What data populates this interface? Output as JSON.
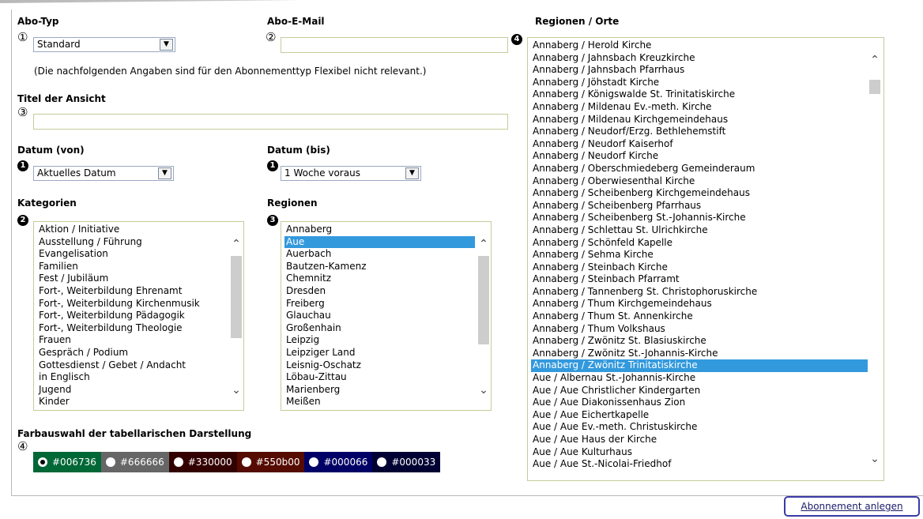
{
  "abo_typ": {
    "label": "Abo-Typ",
    "marker": "①",
    "value": "Standard"
  },
  "abo_email": {
    "label": "Abo-E-Mail",
    "marker": "②",
    "value": ""
  },
  "note": "(Die nachfolgenden Angaben sind für den Abonnementtyp Flexibel nicht relevant.)",
  "titel": {
    "label": "Titel der Ansicht",
    "marker": "③",
    "value": ""
  },
  "datum_von": {
    "label": "Datum (von)",
    "marker": "1",
    "value": "Aktuelles Datum"
  },
  "datum_bis": {
    "label": "Datum (bis)",
    "marker": "1",
    "value": "1 Woche voraus"
  },
  "kategorien": {
    "label": "Kategorien",
    "marker": "2",
    "items": [
      "Aktion / Initiative",
      "Ausstellung / Führung",
      "Evangelisation",
      "Familien",
      "Fest / Jubiläum",
      "Fort-, Weiterbildung Ehrenamt",
      "Fort-, Weiterbildung Kirchenmusik",
      "Fort-, Weiterbildung Pädagogik",
      "Fort-, Weiterbildung Theologie",
      "Frauen",
      "Gespräch / Podium",
      "Gottesdienst / Gebet / Andacht",
      "in Englisch",
      "Jugend",
      "Kinder"
    ]
  },
  "regionen": {
    "label": "Regionen",
    "marker": "3",
    "selected_index": 1,
    "items": [
      "Annaberg",
      "Aue",
      "Auerbach",
      "Bautzen-Kamenz",
      "Chemnitz",
      "Dresden",
      "Freiberg",
      "Glauchau",
      "Großenhain",
      "Leipzig",
      "Leipziger Land",
      "Leisnig-Oschatz",
      "Löbau-Zittau",
      "Marienberg",
      "Meißen"
    ]
  },
  "orte": {
    "label": "Regionen / Orte",
    "marker": "4",
    "selected_index": 26,
    "items": [
      "Annaberg / Herold Kirche",
      "Annaberg / Jahnsbach Kreuzkirche",
      "Annaberg / Jahnsbach Pfarrhaus",
      "Annaberg / Jöhstadt Kirche",
      "Annaberg / Königswalde St. Trinitatiskirche",
      "Annaberg / Mildenau Ev.-meth. Kirche",
      "Annaberg / Mildenau Kirchgemeindehaus",
      "Annaberg / Neudorf/Erzg. Bethlehemstift",
      "Annaberg / Neudorf Kaiserhof",
      "Annaberg / Neudorf Kirche",
      "Annaberg / Oberschmiedeberg Gemeinderaum",
      "Annaberg / Oberwiesenthal Kirche",
      "Annaberg / Scheibenberg Kirchgemeindehaus",
      "Annaberg / Scheibenberg Pfarrhaus",
      "Annaberg / Scheibenberg St.-Johannis-Kirche",
      "Annaberg / Schlettau St. Ulrichkirche",
      "Annaberg / Schönfeld Kapelle",
      "Annaberg / Sehma Kirche",
      "Annaberg / Steinbach Kirche",
      "Annaberg / Steinbach Pfarramt",
      "Annaberg / Tannenberg St. Christophoruskirche",
      "Annaberg / Thum Kirchgemeindehaus",
      "Annaberg / Thum St. Annenkirche",
      "Annaberg / Thum Volkshaus",
      "Annaberg / Zwönitz St. Blasiuskirche",
      "Annaberg / Zwönitz St.-Johannis-Kirche",
      "Annaberg / Zwönitz Trinitatiskirche",
      "Aue / Albernau St.-Johannis-Kirche",
      "Aue / Aue Christlicher Kindergarten",
      "Aue / Aue Diakonissenhaus Zion",
      "Aue / Aue Eichertkapelle",
      "Aue / Aue Ev.-meth. Christuskirche",
      "Aue / Aue Haus der Kirche",
      "Aue / Aue Kulturhaus",
      "Aue / Aue St.-Nicolai-Friedhof"
    ]
  },
  "farbauswahl": {
    "label": "Farbauswahl der tabellarischen Darstellung",
    "marker": "④",
    "selected_index": 0,
    "options": [
      "#006736",
      "#666666",
      "#330000",
      "#550b00",
      "#000066",
      "#000033"
    ]
  },
  "submit_label": "Abonnement anlegen"
}
